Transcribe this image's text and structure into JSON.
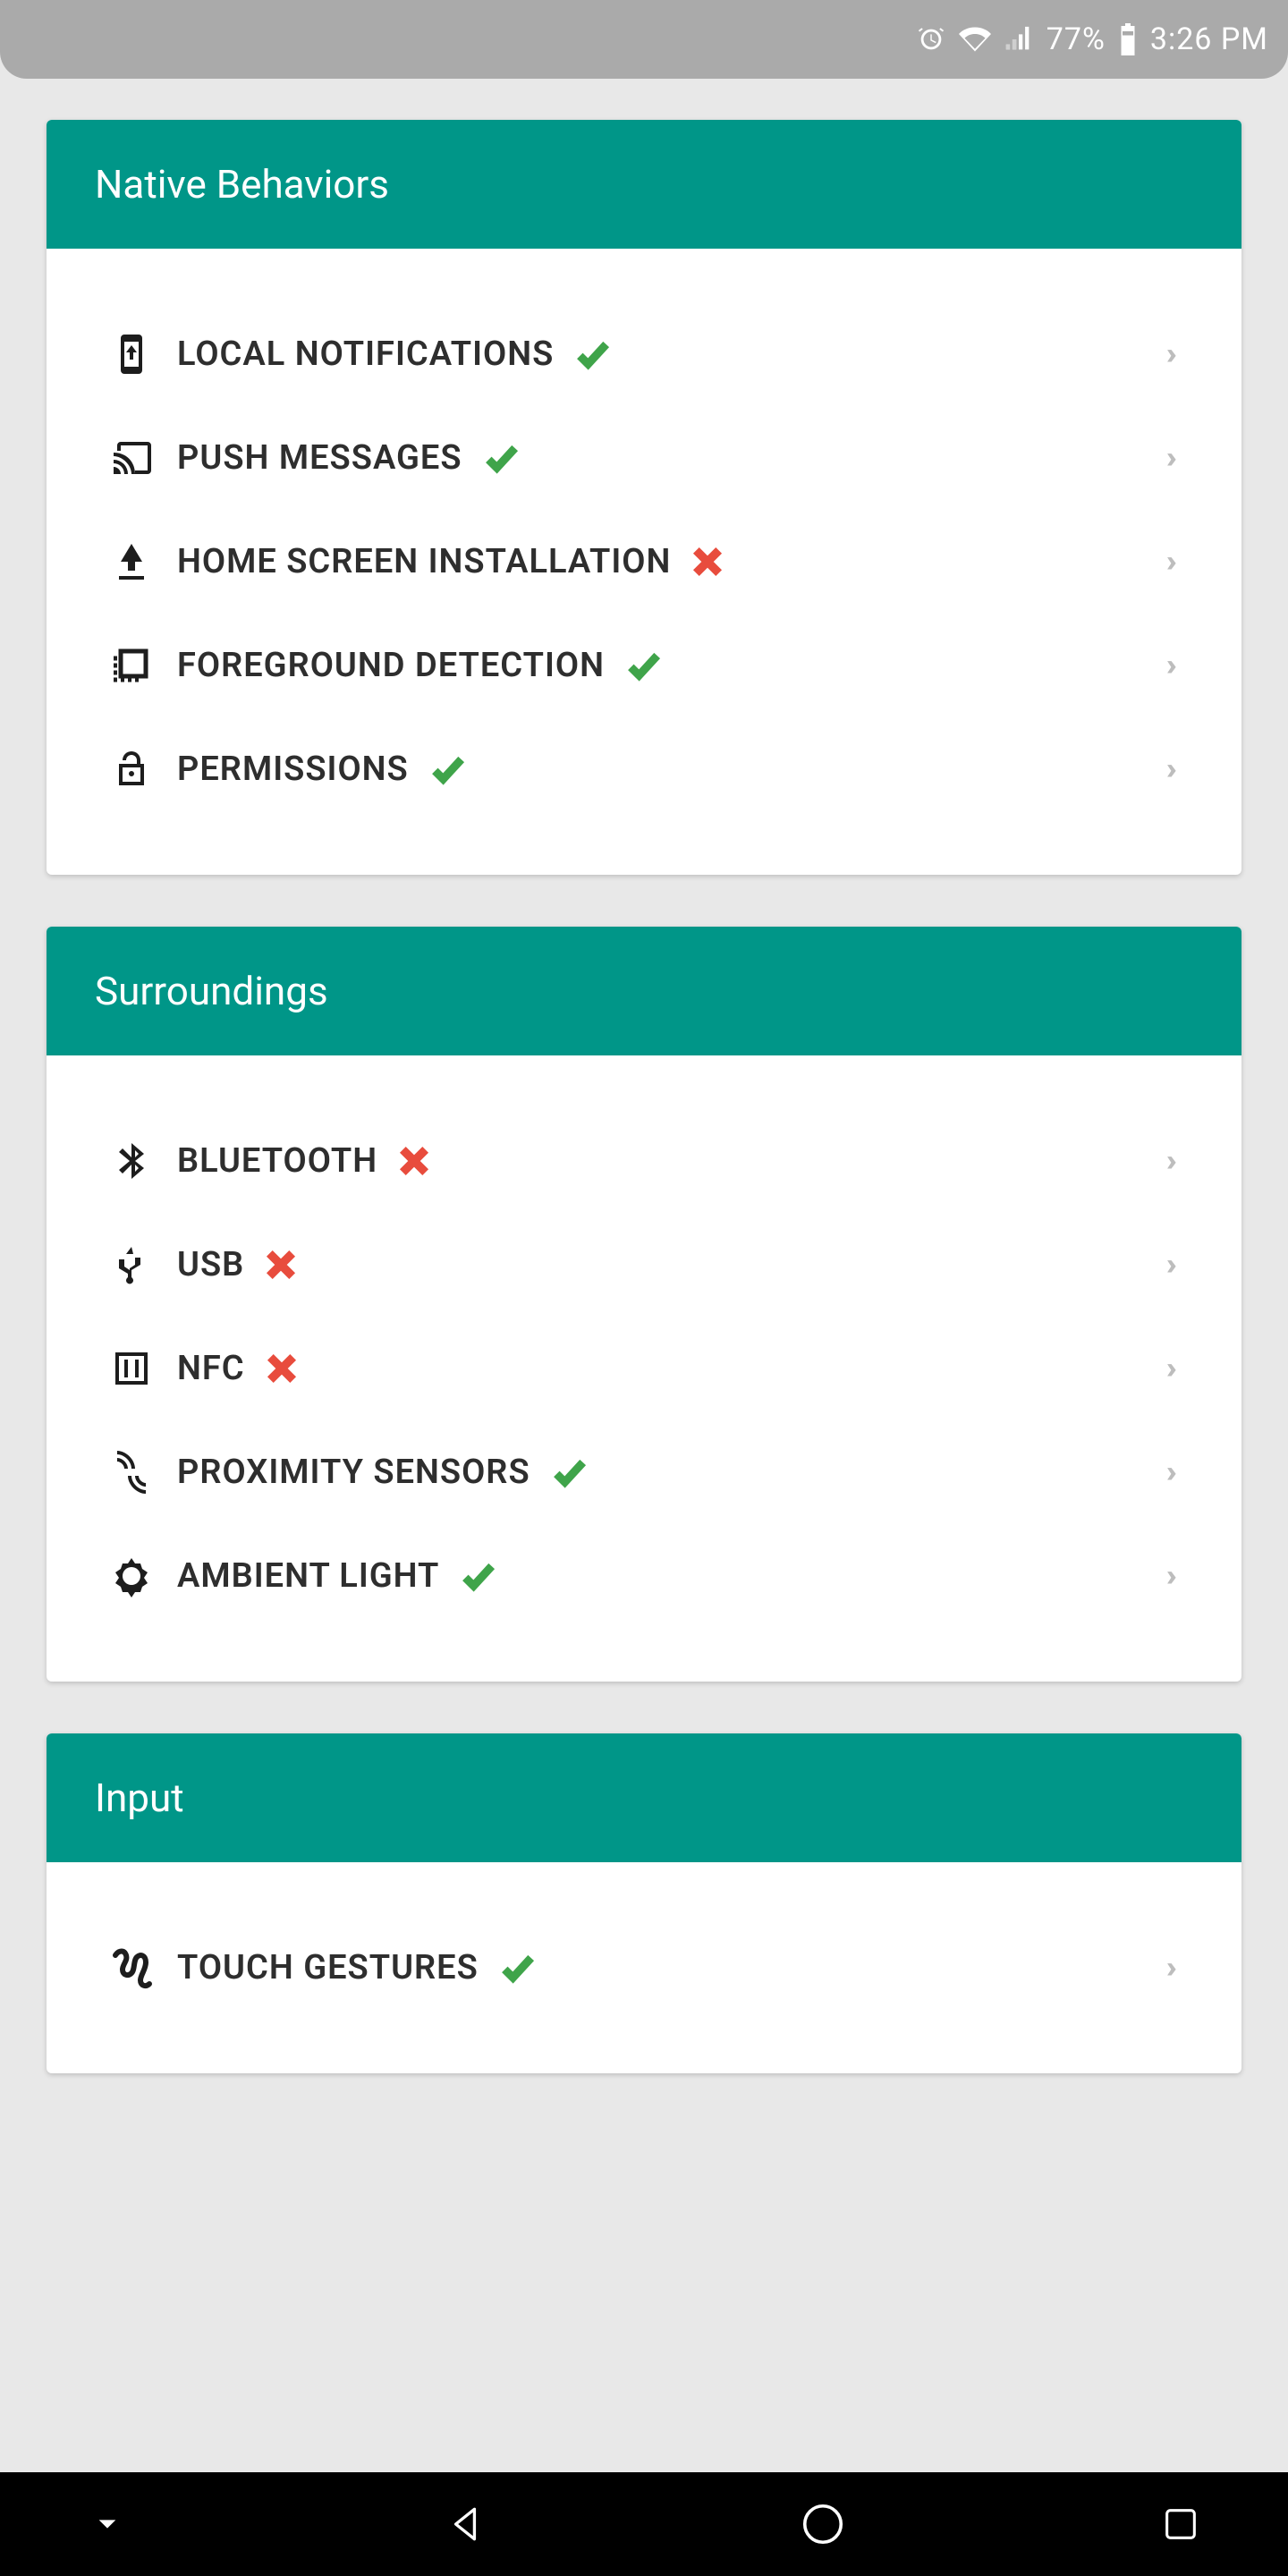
{
  "statusbar": {
    "battery_pct": "77%",
    "time": "3:26 PM"
  },
  "sections": [
    {
      "title": "Native Behaviors",
      "items": [
        {
          "icon": "phone-down-icon",
          "label": "LOCAL NOTIFICATIONS",
          "status": "check"
        },
        {
          "icon": "cast-icon",
          "label": "PUSH MESSAGES",
          "status": "check"
        },
        {
          "icon": "download-icon",
          "label": "HOME SCREEN INSTALLATION",
          "status": "cross"
        },
        {
          "icon": "foreground-icon",
          "label": "FOREGROUND DETECTION",
          "status": "check"
        },
        {
          "icon": "unlock-icon",
          "label": "PERMISSIONS",
          "status": "check"
        }
      ]
    },
    {
      "title": "Surroundings",
      "items": [
        {
          "icon": "bluetooth-icon",
          "label": "BLUETOOTH",
          "status": "cross"
        },
        {
          "icon": "usb-icon",
          "label": "USB",
          "status": "cross"
        },
        {
          "icon": "nfc-icon",
          "label": "NFC",
          "status": "cross"
        },
        {
          "icon": "proximity-icon",
          "label": "PROXIMITY SENSORS",
          "status": "check"
        },
        {
          "icon": "brightness-icon",
          "label": "AMBIENT LIGHT",
          "status": "check"
        }
      ]
    },
    {
      "title": "Input",
      "items": [
        {
          "icon": "gesture-icon",
          "label": "TOUCH GESTURES",
          "status": "check"
        }
      ]
    }
  ],
  "chevron": "››"
}
